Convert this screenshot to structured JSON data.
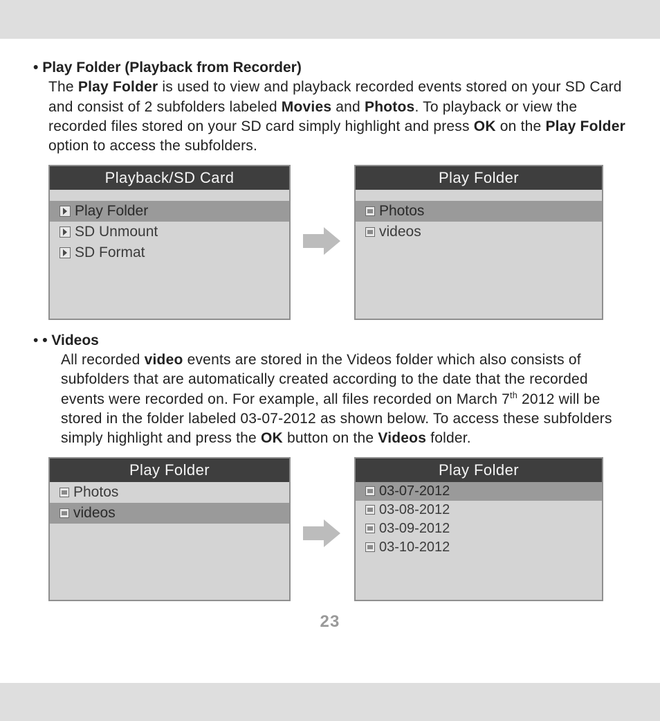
{
  "page_number": "23",
  "section1": {
    "heading": "Play Folder (Playback from Recorder)",
    "p1_a": "The ",
    "p1_b": "Play Folder",
    "p1_c": " is used to view and playback recorded events stored on your SD Card and consist of 2 subfolders labeled ",
    "p1_d": "Movies",
    "p1_e": " and ",
    "p1_f": "Photos",
    "p1_g": ". To playback or view the recorded files stored on your SD card simply highlight and press ",
    "p1_h": "OK",
    "p1_i": " on the ",
    "p1_j": "Play Folder",
    "p1_k": " option to access the subfolders."
  },
  "menu1": {
    "title": "Playback/SD Card",
    "items": [
      "Play Folder",
      "SD Unmount",
      "SD Format"
    ],
    "selected": 0
  },
  "menu2": {
    "title": "Play Folder",
    "items": [
      "Photos",
      "videos"
    ],
    "selected": 0
  },
  "section2": {
    "heading": "Videos",
    "p_a": "All recorded ",
    "p_b": "video",
    "p_c": " events are stored in the Videos folder which also consists of subfolders that are automatically created according to the date that the recorded events were recorded on. For example, all files recorded on March 7",
    "p_sup": "th",
    "p_d": " 2012 will be stored in the folder labeled 03-07-2012 as shown below. To access these subfolders simply highlight and press the ",
    "p_e": "OK",
    "p_f": " button on the ",
    "p_g": "Videos",
    "p_h": " folder."
  },
  "menu3": {
    "title": "Play Folder",
    "items": [
      "Photos",
      "videos"
    ],
    "selected": 1
  },
  "menu4": {
    "title": "Play Folder",
    "items": [
      "03-07-2012",
      "03-08-2012",
      "03-09-2012",
      "03-10-2012"
    ],
    "selected": 0
  }
}
